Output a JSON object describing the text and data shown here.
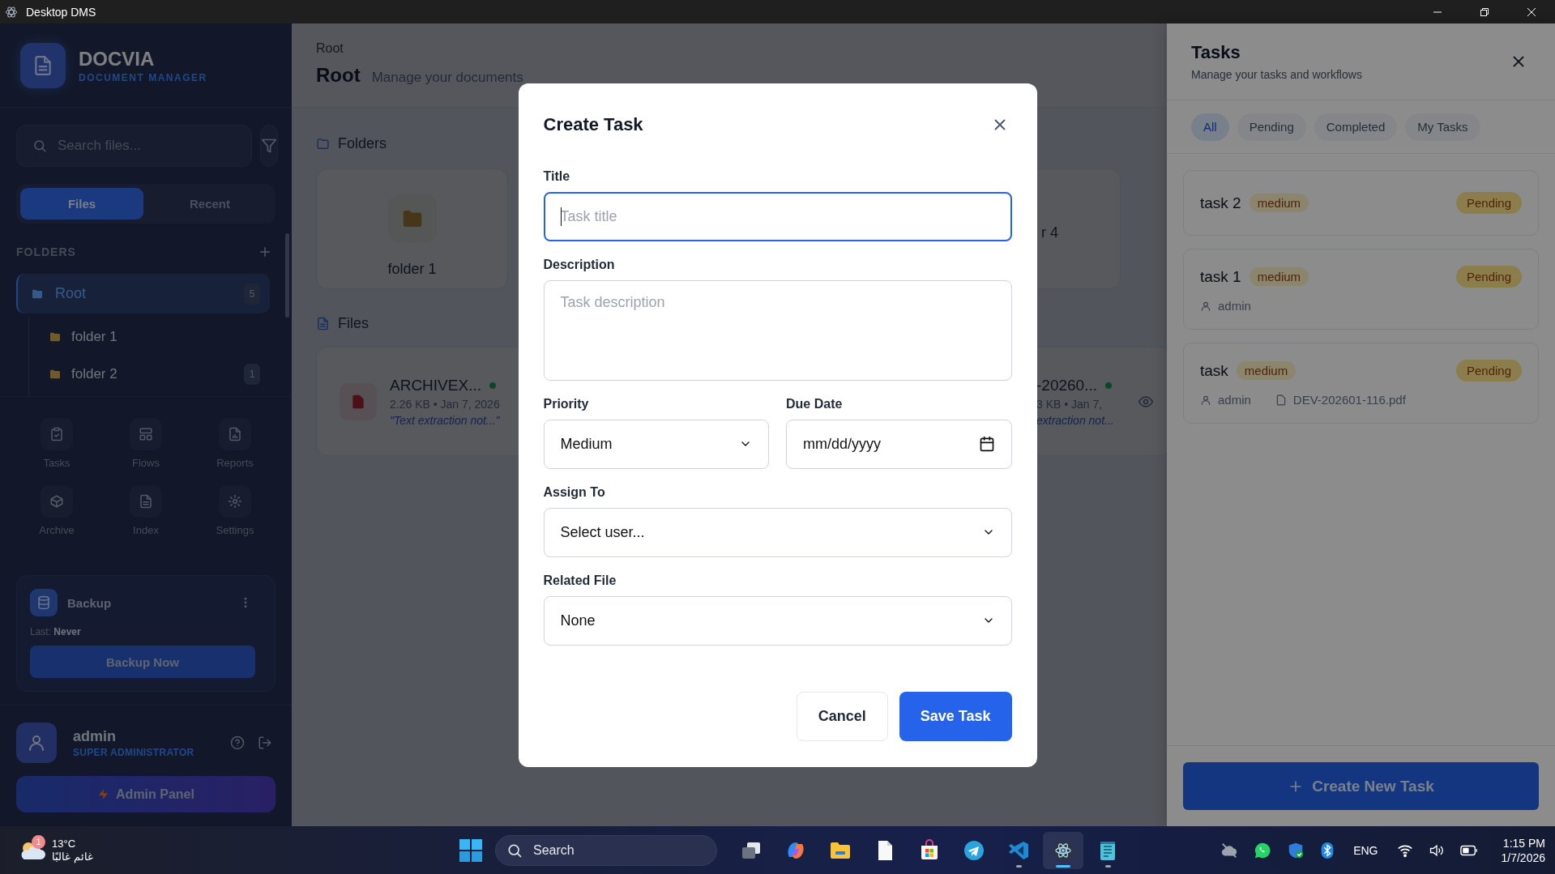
{
  "titlebar": {
    "title": "Desktop DMS"
  },
  "sidebar": {
    "brand": {
      "name": "DOCVIA",
      "tagline": "DOCUMENT MANAGER"
    },
    "search": {
      "placeholder": "Search files..."
    },
    "tabs": [
      {
        "label": "Files",
        "selected": true
      },
      {
        "label": "Recent",
        "selected": false
      }
    ],
    "folders": {
      "heading": "FOLDERS",
      "items": [
        {
          "label": "Root",
          "count": "5",
          "selected": true,
          "children": [
            {
              "label": "folder 1",
              "selected": false
            },
            {
              "label": "folder 2",
              "count": "1",
              "selected": false
            }
          ]
        }
      ]
    },
    "shortcuts": [
      {
        "label": "Tasks",
        "kind": "tasks"
      },
      {
        "label": "Flows",
        "kind": "flows"
      },
      {
        "label": "Reports",
        "kind": "reports"
      },
      {
        "label": "Archive",
        "kind": "archive"
      },
      {
        "label": "Index",
        "kind": "index"
      },
      {
        "label": "Settings",
        "kind": "settings"
      }
    ],
    "backup": {
      "title": "Backup",
      "last_label": "Last:",
      "last_value": "Never",
      "button": "Backup Now"
    },
    "user": {
      "name": "admin",
      "role": "SUPER ADMINISTRATOR"
    },
    "admin_button": "Admin Panel"
  },
  "main": {
    "breadcrumb": "Root",
    "title": "Root",
    "subtitle": "Manage your documents",
    "folders_heading": "Folders",
    "folders": [
      {
        "label": "folder 1"
      },
      {
        "label": "r 4"
      }
    ],
    "files_heading": "Files",
    "files": [
      {
        "name": "ARCHIVEX...",
        "meta": "2.26 KB • Jan 7, 2026",
        "preview": "\"Text extraction not...\"",
        "synced": true
      },
      {
        "name": "-20260...",
        "meta": "3 KB • Jan 7,",
        "preview": "extraction not...",
        "synced": true
      }
    ]
  },
  "tasks_panel": {
    "title": "Tasks",
    "subtitle": "Manage your tasks and workflows",
    "filters": [
      {
        "label": "All",
        "selected": true
      },
      {
        "label": "Pending",
        "selected": false
      },
      {
        "label": "Completed",
        "selected": false
      },
      {
        "label": "My Tasks",
        "selected": false
      }
    ],
    "tasks": [
      {
        "title": "task 2",
        "priority": "medium",
        "status": "Pending"
      },
      {
        "title": "task 1",
        "priority": "medium",
        "status": "Pending",
        "assignee": "admin"
      },
      {
        "title": "task",
        "priority": "medium",
        "status": "Pending",
        "assignee": "admin",
        "file": "DEV-202601-116.pdf"
      }
    ],
    "create_button": "Create New Task"
  },
  "modal": {
    "title": "Create Task",
    "rows": [
      [
        {
          "kind": "text",
          "label": "Title",
          "placeholder": "Task title",
          "focused": true
        }
      ],
      [
        {
          "kind": "textarea",
          "label": "Description",
          "placeholder": "Task description",
          "focused": false
        }
      ],
      [
        {
          "kind": "select",
          "label": "Priority",
          "value": "Medium",
          "focused": false
        },
        {
          "kind": "date",
          "label": "Due Date",
          "value": "mm/dd/yyyy",
          "focused": false
        }
      ],
      [
        {
          "kind": "select",
          "label": "Assign To",
          "value": "Select user...",
          "focused": false
        }
      ],
      [
        {
          "kind": "select",
          "label": "Related File",
          "value": "None",
          "focused": false
        }
      ]
    ],
    "buttons": [
      {
        "label": "Cancel",
        "kind": "secondary"
      },
      {
        "label": "Save Task",
        "kind": "primary"
      }
    ]
  },
  "taskbar": {
    "weather": {
      "badge": "1",
      "temp": "13°C",
      "condition": "غائم غالبًا"
    },
    "search": {
      "placeholder": "Search"
    },
    "apps": [
      {
        "kind": "taskview",
        "running": false,
        "active": false
      },
      {
        "kind": "copilot",
        "running": false,
        "active": false
      },
      {
        "kind": "explorer",
        "running": false,
        "active": false
      },
      {
        "kind": "file",
        "running": false,
        "active": false
      },
      {
        "kind": "store",
        "running": false,
        "active": false
      },
      {
        "kind": "telegram",
        "running": false,
        "active": false
      },
      {
        "kind": "vscode",
        "running": true,
        "active": false
      },
      {
        "kind": "electron",
        "running": true,
        "active": true
      },
      {
        "kind": "notepad",
        "running": true,
        "active": false
      }
    ],
    "tray": {
      "language": "ENG",
      "time": "1:15 PM",
      "date": "1/7/2026"
    }
  }
}
